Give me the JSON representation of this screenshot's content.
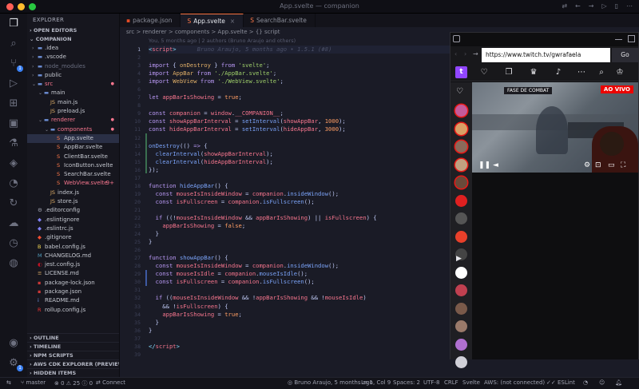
{
  "window": {
    "title": "App.svelte — companion",
    "accent": "#ff7849"
  },
  "sidebar": {
    "title": "EXPLORER",
    "sections": {
      "open_editors": "OPEN EDITORS",
      "workspace": "COMPANION",
      "outline": "OUTLINE",
      "timeline": "TIMELINE",
      "npm_scripts": "NPM SCRIPTS",
      "aws_cdk": "AWS CDK EXPLORER (PREVIEW)",
      "hidden_items": "HIDDEN ITEMS"
    },
    "tree": [
      {
        "label": ".idea",
        "depth": 1,
        "kind": "folder"
      },
      {
        "label": ".vscode",
        "depth": 1,
        "kind": "folder"
      },
      {
        "label": "node_modules",
        "depth": 1,
        "kind": "folder",
        "muted": true
      },
      {
        "label": "public",
        "depth": 1,
        "kind": "folder"
      },
      {
        "label": "src",
        "depth": 1,
        "kind": "folder-open",
        "modified": true
      },
      {
        "label": "main",
        "depth": 2,
        "kind": "folder-open"
      },
      {
        "label": "main.js",
        "depth": 3,
        "kind": "js"
      },
      {
        "label": "preload.js",
        "depth": 3,
        "kind": "js"
      },
      {
        "label": "renderer",
        "depth": 2,
        "kind": "folder-open",
        "modified": true
      },
      {
        "label": "components",
        "depth": 3,
        "kind": "folder-open",
        "modified": true
      },
      {
        "label": "App.svelte",
        "depth": 4,
        "kind": "svelte",
        "selected": true
      },
      {
        "label": "AppBar.svelte",
        "depth": 4,
        "kind": "svelte"
      },
      {
        "label": "ClientBar.svelte",
        "depth": 4,
        "kind": "svelte"
      },
      {
        "label": "IconButton.svelte",
        "depth": 4,
        "kind": "svelte"
      },
      {
        "label": "SearchBar.svelte",
        "depth": 4,
        "kind": "svelte"
      },
      {
        "label": "WebView.svelte",
        "depth": 4,
        "kind": "svelte",
        "modified": true,
        "badge": "9+"
      },
      {
        "label": "index.js",
        "depth": 3,
        "kind": "js"
      },
      {
        "label": "store.js",
        "depth": 3,
        "kind": "js"
      },
      {
        "label": ".editorconfig",
        "depth": 1,
        "kind": "gear"
      },
      {
        "label": ".eslintignore",
        "depth": 1,
        "kind": "eslint"
      },
      {
        "label": ".eslintrc.js",
        "depth": 1,
        "kind": "eslint"
      },
      {
        "label": ".gitignore",
        "depth": 1,
        "kind": "git"
      },
      {
        "label": "babel.config.js",
        "depth": 1,
        "kind": "babel"
      },
      {
        "label": "CHANGELOG.md",
        "depth": 1,
        "kind": "md"
      },
      {
        "label": "jest.config.js",
        "depth": 1,
        "kind": "jest"
      },
      {
        "label": "LICENSE.md",
        "depth": 1,
        "kind": "license"
      },
      {
        "label": "package-lock.json",
        "depth": 1,
        "kind": "npm"
      },
      {
        "label": "package.json",
        "depth": 1,
        "kind": "npm"
      },
      {
        "label": "README.md",
        "depth": 1,
        "kind": "info"
      },
      {
        "label": "rollup.config.js",
        "depth": 1,
        "kind": "rollup"
      }
    ]
  },
  "tabs": [
    {
      "label": "package.json",
      "active": false
    },
    {
      "label": "App.svelte",
      "active": true
    },
    {
      "label": "SearchBar.svelte",
      "active": false
    }
  ],
  "breadcrumb": "src > renderer > components > App.svelte > {} script",
  "editor": {
    "blame_header": "You, 5 months ago | 2 authors (Bruno Araujo and others)",
    "inline_blame": "Bruno Araujo, 5 months ago • 1.5.1 (#8)",
    "current_line": 1
  },
  "overlay": {
    "url": "https://www.twitch.tv/gwrafaela",
    "go_label": "Go",
    "live_label": "AO VIVO",
    "scoreboard": "FASE DE COMBAT"
  },
  "statusbar": {
    "branch": "master",
    "errors": "0",
    "warnings": "25",
    "info": "0",
    "connect": "Connect",
    "blame": "Bruno Araujo, 5 months ago",
    "position": "Ln 1, Col 9",
    "spaces": "Spaces: 2",
    "encoding": "UTF-8",
    "eol": "CRLF",
    "language": "Svelte",
    "aws": "AWS: (not connected)",
    "eslint": "ESLint"
  },
  "colors": {
    "keyword": "#bb9af7",
    "string": "#9ece6a",
    "function": "#7aa2f7",
    "identifier": "#e0af68",
    "variable": "#f7768e",
    "number": "#ff9e64",
    "twitch_purple": "#9146ff",
    "live_red": "#eb0400"
  }
}
